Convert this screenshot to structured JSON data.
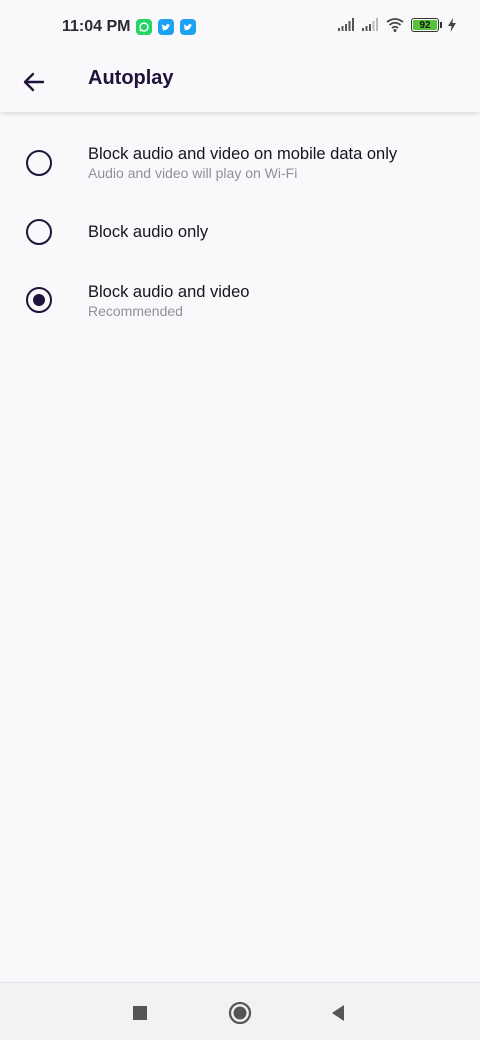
{
  "status_bar": {
    "time": "11:04 PM",
    "battery_level": "92",
    "notification_icons": [
      "whatsapp-icon",
      "twitter-icon",
      "twitter-icon"
    ],
    "colors": {
      "whatsapp": "#25d366",
      "twitter": "#1da1f2",
      "battery": "#55c23b"
    }
  },
  "app_bar": {
    "title": "Autoplay",
    "back_icon": "arrow-left-icon"
  },
  "options": [
    {
      "label": "Block audio and video on mobile data only",
      "subtitle": "Audio and video will play on Wi-Fi",
      "selected": false
    },
    {
      "label": "Block audio only",
      "subtitle": "",
      "selected": false
    },
    {
      "label": "Block audio and video",
      "subtitle": "Recommended",
      "selected": true
    }
  ],
  "nav_bar": {
    "buttons": [
      "recents-square-icon",
      "home-circle-icon",
      "back-triangle-icon"
    ]
  },
  "colors": {
    "accent": "#20123a",
    "background": "#f9f9fb",
    "secondary_text": "#8f8f9d"
  }
}
